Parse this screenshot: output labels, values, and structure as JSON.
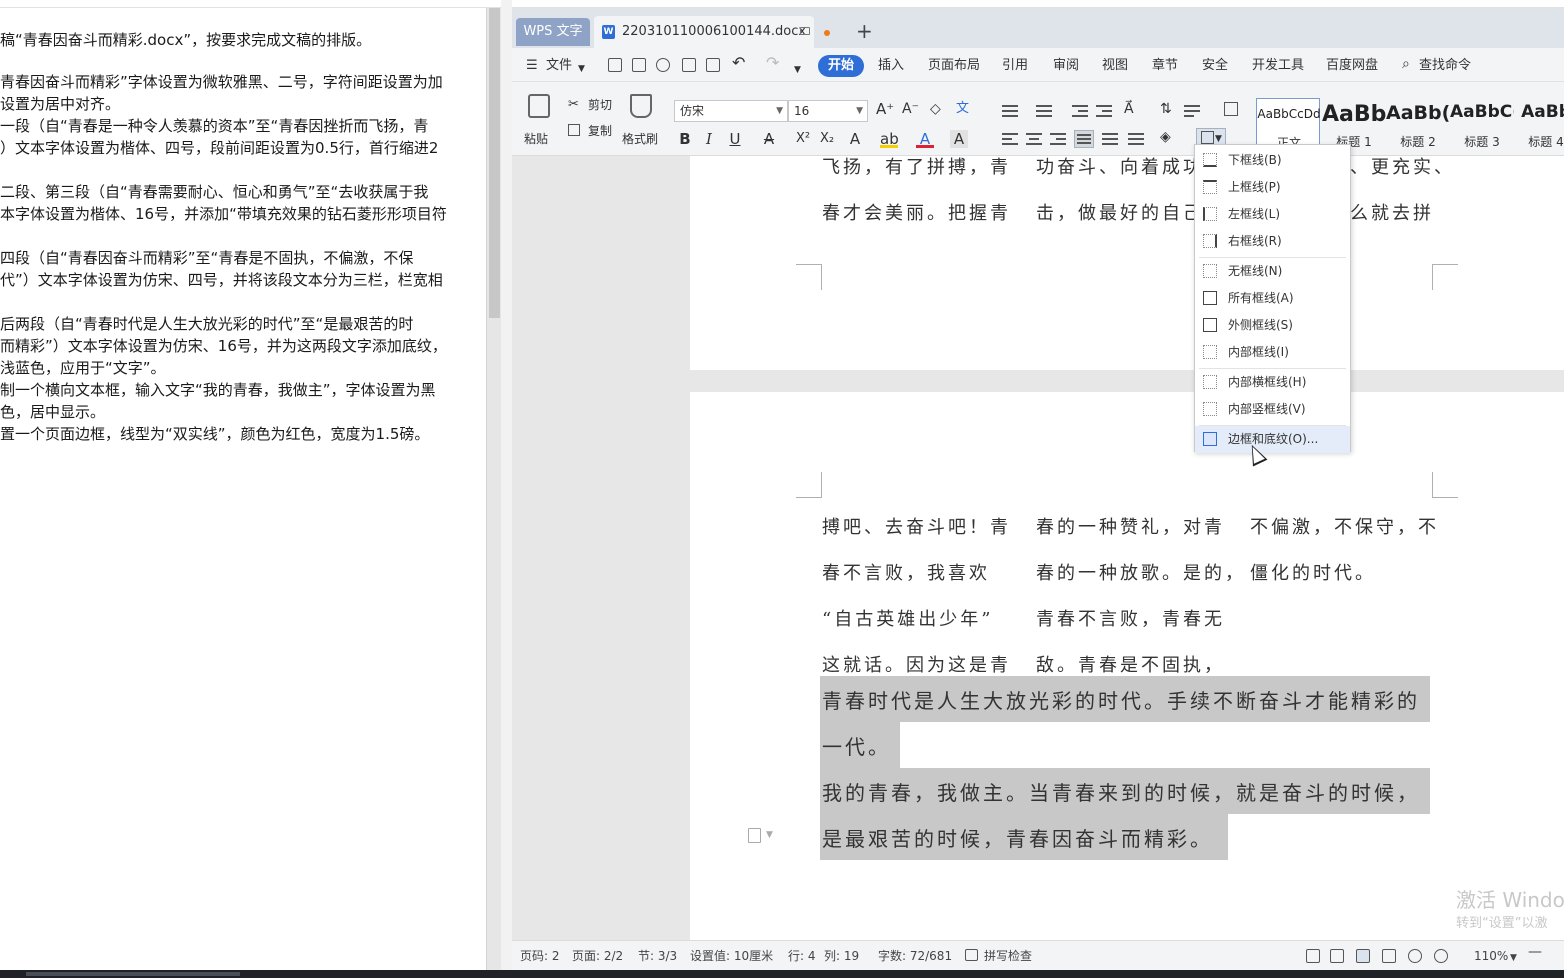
{
  "instructions": {
    "lines": [
      "稿“青春因奋斗而精彩.docx”，按要求完成文稿的排版。",
      "青春因奋斗而精彩”字体设置为微软雅黑、二号，字符间距设置为加",
      "设置为居中对齐。",
      "一段（自“青春是一种令人羡慕的资本”至“青春因挫折而飞扬，青",
      "）文本字体设置为楷体、四号，段前间距设置为0.5行，首行缩进2",
      "二段、第三段（自“青春需要耐心、恒心和勇气”至“去收获属于我",
      "本字体设置为楷体、16号，并添加“带填充效果的钻石菱形形项目符",
      "四段（自“青春因奋斗而精彩”至“青春是不固执，不偏激，不保",
      "代”）文本字体设置为仿宋、四号，并将该段文本分为三栏，栏宽相",
      "后两段（自“青春时代是人生大放光彩的时代”至“是最艰苦的时",
      "而精彩”）文本字体设置为仿宋、16号，并为这两段文字添加底纹，",
      "浅蓝色，应用于“文字”。",
      "制一个横向文本框，输入文字“我的青春，我做主”，字体设置为黑",
      "色，居中显示。",
      "置一个页面边框，线型为“双实线”，颜色为红色，宽度为1.5磅。"
    ]
  },
  "tabs": {
    "app_tab": "WPS 文字",
    "doc_tab": "220310110006100144.docx",
    "new_tab": "+"
  },
  "menu": {
    "file": "文件",
    "items": [
      "开始",
      "插入",
      "页面布局",
      "引用",
      "审阅",
      "视图",
      "章节",
      "安全",
      "开发工具",
      "百度网盘"
    ],
    "search": "查找命令"
  },
  "ribbon": {
    "paste": "粘贴",
    "cut": "剪切",
    "copy": "复制",
    "format_painter": "格式刷",
    "font_name": "仿宋",
    "font_size": "16",
    "styles": [
      {
        "sample": "AaBbCcDd",
        "caption": "正文"
      },
      {
        "sample": "AaBb",
        "caption": "标题 1"
      },
      {
        "sample": "AaBb(",
        "caption": "标题 2"
      },
      {
        "sample": "AaBbC(",
        "caption": "标题 3"
      },
      {
        "sample": "AaBb",
        "caption": "标题 4"
      }
    ]
  },
  "document": {
    "page1_col1": [
      "飞扬，有了拼搏，青",
      "春才会美丽。把握青"
    ],
    "page1_col2": [
      "功奋斗、向着成功",
      "击，做最好的自己"
    ],
    "page1_col3": [
      "、更充实、",
      "么就去拼"
    ],
    "page2_col1": [
      "搏吧、去奋斗吧！青",
      "春不言败，我喜欢",
      "“自古英雄出少年”",
      "这就话。因为这是青"
    ],
    "page2_col2": [
      "春的一种赞礼，对青",
      "春的一种放歌。是的，",
      "青春不言败，青春无",
      "敌。青春是不固执，"
    ],
    "page2_col3": [
      "不偏激，不保守，不",
      "僵化的时代。"
    ],
    "shaded_lines": [
      "青春时代是人生大放光彩的时代。手续不断奋斗才能精彩的",
      "一代。",
      "我的青春，我做主。当青春来到的时候，就是奋斗的时候，",
      "是最艰苦的时候，青春因奋斗而精彩。"
    ],
    "watermark_title": "激活 Windo",
    "watermark_sub": "转到“设置”以激"
  },
  "border_menu": {
    "items": [
      "下框线(B)",
      "上框线(P)",
      "左框线(L)",
      "右框线(R)",
      "无框线(N)",
      "所有框线(A)",
      "外侧框线(S)",
      "内部框线(I)",
      "内部横框线(H)",
      "内部竖框线(V)",
      "边框和底纹(O)..."
    ]
  },
  "status": {
    "page_num": "页码: 2",
    "pages": "页面: 2/2",
    "section": "节: 3/3",
    "setting": "设置值: 10厘米",
    "row": "行: 4",
    "col": "列: 19",
    "words": "字数: 72/681",
    "spell": "拼写检查",
    "zoom": "110%"
  }
}
